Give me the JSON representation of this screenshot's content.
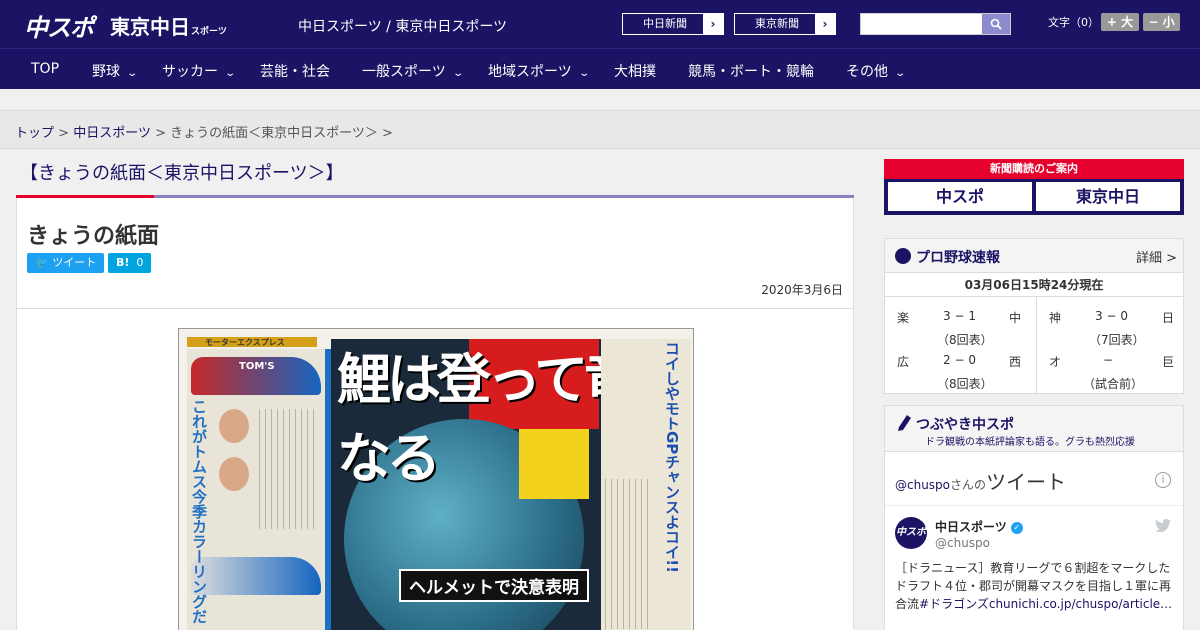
{
  "header": {
    "logo_main": "中スポ",
    "logo_tokyo": "東京中日",
    "logo_tokyo_small": "スポーツ",
    "site_subtitle": "中日スポーツ / 東京中日スポーツ",
    "paper_links": [
      "中日新聞",
      "東京新聞"
    ],
    "search_placeholder": "",
    "font_size_label": "文字（0）",
    "font_increase": "+ 大",
    "font_decrease": "− 小"
  },
  "nav": {
    "items": [
      {
        "label": "TOP",
        "has_menu": false
      },
      {
        "label": "野球",
        "has_menu": true
      },
      {
        "label": "サッカー",
        "has_menu": true
      },
      {
        "label": "芸能・社会",
        "has_menu": false
      },
      {
        "label": "一般スポーツ",
        "has_menu": true
      },
      {
        "label": "地域スポーツ",
        "has_menu": true
      },
      {
        "label": "大相撲",
        "has_menu": false
      },
      {
        "label": "競馬・ボート・競輪",
        "has_menu": false
      },
      {
        "label": "その他",
        "has_menu": true
      }
    ]
  },
  "breadcrumb": {
    "items": [
      "トップ",
      "中日スポーツ",
      "きょうの紙面＜東京中日スポーツ＞"
    ],
    "separator": ">"
  },
  "article": {
    "page_heading": "【きょうの紙面＜東京中日スポーツ＞】",
    "title": "きょうの紙面",
    "tweet_label": "ツイート",
    "hatena_label": "B!",
    "hatena_count": "0",
    "date": "2020年3月6日",
    "image": {
      "headline": "鯉は登って竜になる",
      "tag": "ヘルメットで決意表明",
      "column_left": "これがトムス今季カラーリングだ",
      "column_right": "コイしやモトGPチャンスよコイ!!",
      "section_tag": "モーターエクスプレス",
      "brand_badge": "TOM'S"
    }
  },
  "sidebar": {
    "subscribe": {
      "title": "新聞購読のご案内",
      "logos": [
        "中スポ",
        "東京中日"
      ]
    },
    "baseball": {
      "title": "プロ野球速報",
      "more": "詳細 >",
      "as_of": "03月06日15時24分現在",
      "games": [
        {
          "home": "楽",
          "score": "3 − 1",
          "away": "中",
          "status": "（8回表）"
        },
        {
          "home": "神",
          "score": "3 − 0",
          "away": "日",
          "status": "（7回表）"
        },
        {
          "home": "広",
          "score": "2 − 0",
          "away": "西",
          "status": "（8回表）"
        },
        {
          "home": "オ",
          "score": "−",
          "away": "巨",
          "status": "（試合前）"
        }
      ]
    },
    "twitter": {
      "title": "つぶやき中スポ",
      "subtitle": "ドラ観戦の本紙評論家も語る。グラも熱烈応援",
      "handle_link": "@chuspo",
      "handle_suffix": "さんの",
      "heading": "ツイート",
      "info": "i",
      "avatar_text": "中スポ",
      "account_name": "中日スポーツ",
      "account_handle": "@chuspo",
      "tweet_text": "［ドラニュース］教育リーグで６割超をマークしたドラフト４位・郡司が開幕マスクを目指し１軍に再合流",
      "tweet_hashtag": "#ドラゴンズ",
      "tweet_link": "chunichi.co.jp/chuspo/article…"
    }
  },
  "colors": {
    "brand_navy": "#1b1464",
    "accent_red": "#e5002d",
    "twitter_blue": "#1da1f2"
  }
}
